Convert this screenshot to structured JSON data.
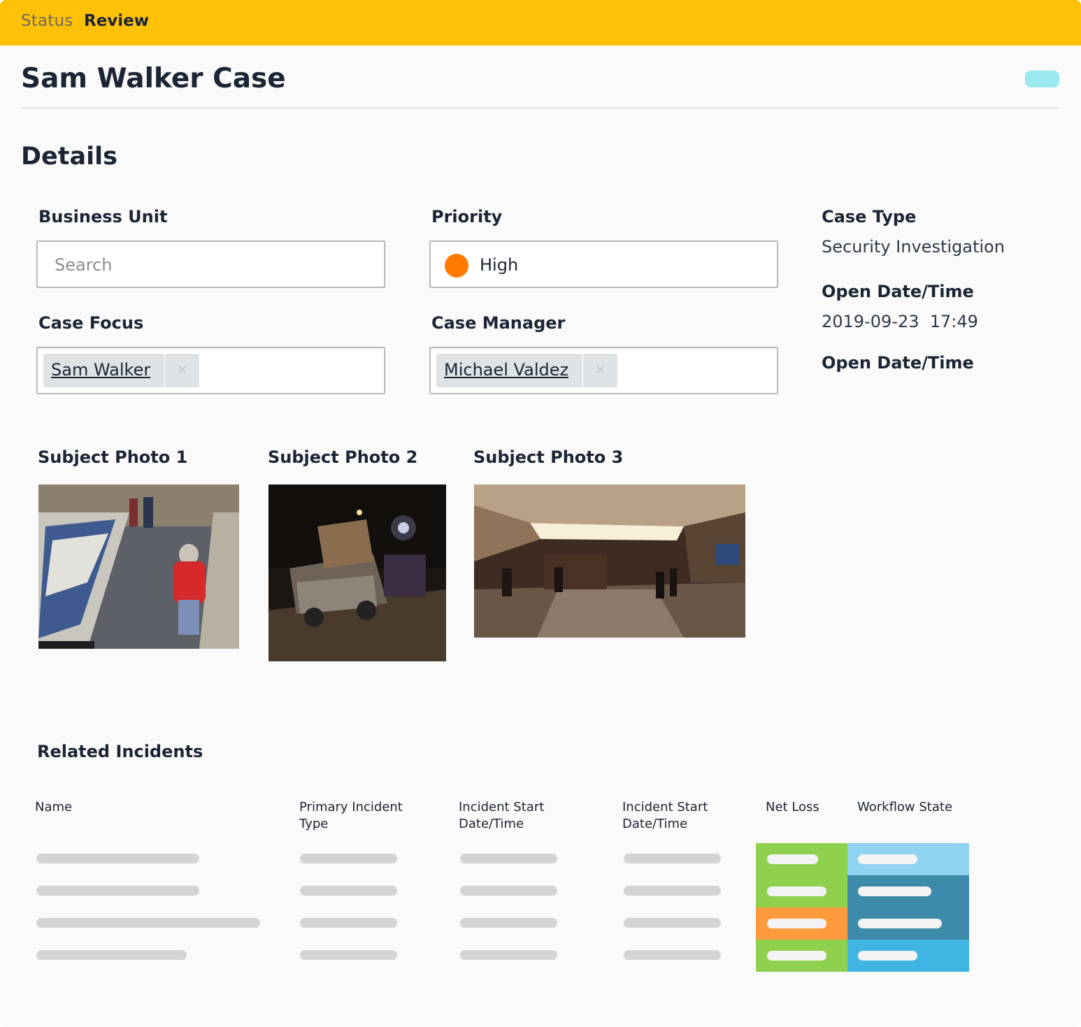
{
  "status": {
    "label": "Status",
    "value": "Review"
  },
  "case": {
    "title": "Sam Walker Case"
  },
  "details": {
    "section_title": "Details",
    "business_unit": {
      "label": "Business Unit",
      "placeholder": "Search"
    },
    "priority": {
      "label": "Priority",
      "value": "High",
      "color": "#ff7b00"
    },
    "case_type": {
      "label": "Case Type",
      "value": "Security Investigation"
    },
    "open_date": {
      "label": "Open Date/Time",
      "value": "2019-09-23  17:49"
    },
    "open_date_2": {
      "label": "Open Date/Time"
    },
    "case_focus": {
      "label": "Case Focus",
      "chip": "Sam Walker",
      "remove": "×"
    },
    "case_manager": {
      "label": "Case Manager",
      "chip": "Michael Valdez",
      "remove": "×"
    }
  },
  "photos": [
    {
      "label": "Subject Photo 1"
    },
    {
      "label": "Subject Photo 2"
    },
    {
      "label": "Subject Photo 3"
    }
  ],
  "related": {
    "title": "Related Incidents",
    "columns": [
      "Name",
      "Primary Incident Type",
      "Incident Start Date/Time",
      "Incident Start Date/Time",
      "Net Loss",
      "Workflow State"
    ],
    "net_loss_colors": [
      "#8fd14f",
      "#8fd14f",
      "#ff9b3d",
      "#8fd14f"
    ],
    "workflow_colors": [
      "#8fd3ef",
      "#3e8aab",
      "#3e8aab",
      "#3fb4e2"
    ]
  }
}
